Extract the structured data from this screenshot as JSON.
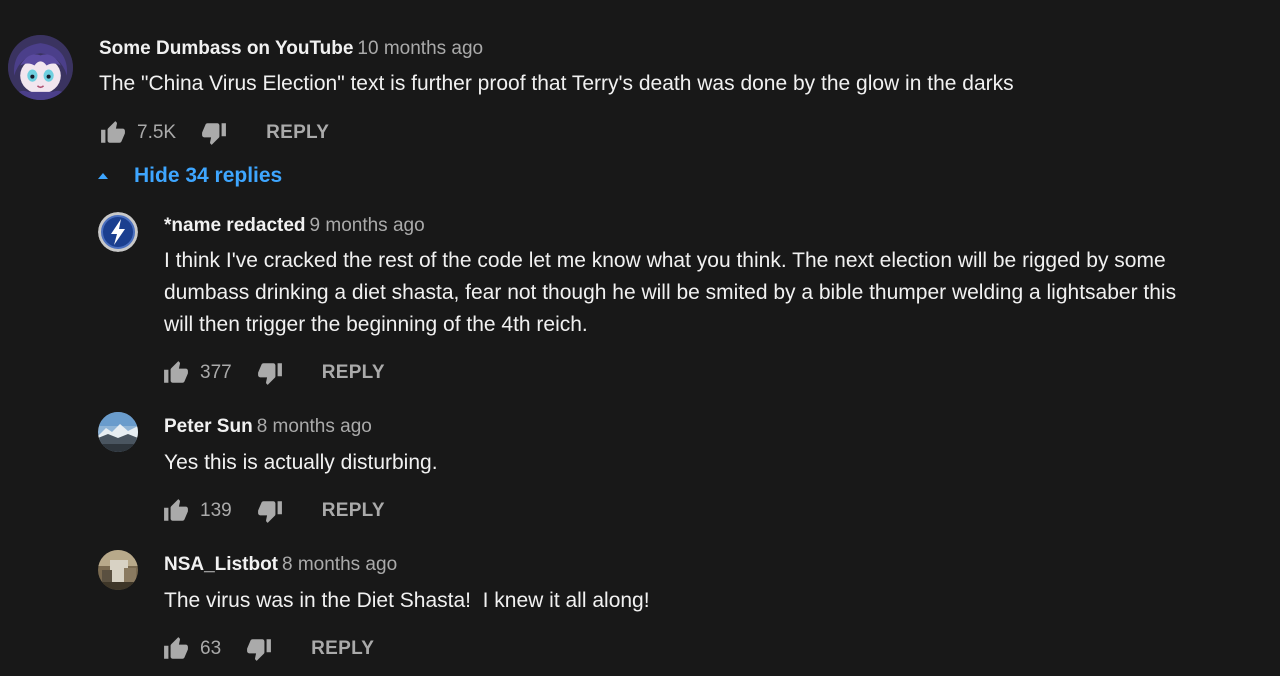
{
  "colors": {
    "background": "#181818",
    "text_primary": "#f1f1f1",
    "text_secondary": "#aaaaaa",
    "link_blue": "#3ea6ff"
  },
  "top_comment": {
    "author": "Some Dumbass on YouTube",
    "time": "10 months ago",
    "text": "The \"China Virus Election\" text is further proof that Terry's death was done by the glow in the darks",
    "likes": "7.5K",
    "reply_label": "REPLY",
    "avatar_icon": "anime-avatar-icon"
  },
  "replies_toggle": {
    "label": "Hide 34 replies",
    "icon": "caret-up-icon"
  },
  "replies": [
    {
      "author": "*name redacted",
      "time": "9 months ago",
      "text_lines": [
        "I think I've cracked the rest of the code let me know what you think. The next election will be rigged by some",
        "dumbass drinking a diet shasta, fear not though he will be smited by a bible thumper welding a lightsaber this",
        "will then trigger the beginning of the 4th reich."
      ],
      "likes": "377",
      "reply_label": "REPLY",
      "avatar_icon": "lightning-bolt-avatar-icon"
    },
    {
      "author": "Peter Sun",
      "time": "8 months ago",
      "text_lines": [
        "Yes this is actually disturbing."
      ],
      "likes": "139",
      "reply_label": "REPLY",
      "avatar_icon": "landscape-avatar-icon"
    },
    {
      "author": "NSA_Listbot",
      "time": "8 months ago",
      "text_lines": [
        "The virus was in the Diet Shasta!  I knew it all along!"
      ],
      "likes": "63",
      "reply_label": "REPLY",
      "avatar_icon": "photo-avatar-icon"
    }
  ]
}
